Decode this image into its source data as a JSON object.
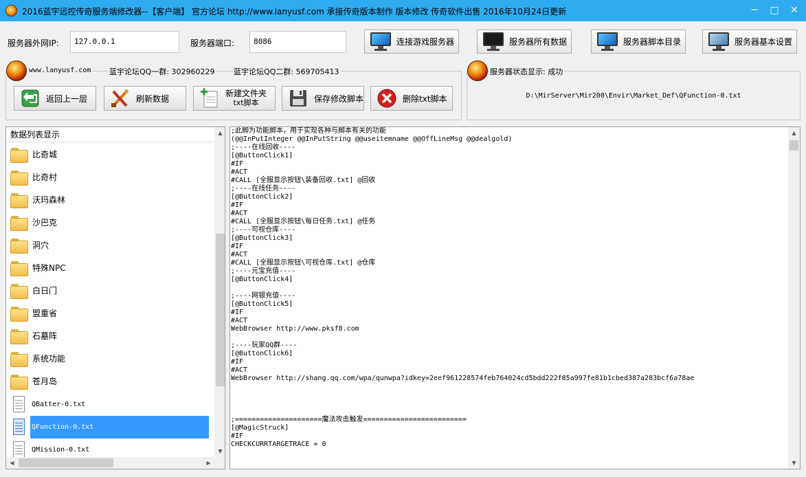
{
  "window": {
    "title": "2016蓝宇远控传奇服务端修改器--【客户端】   官方论坛 http://www.lanyusf.com  承接传奇版本制作 版本修改 传奇软件出售 2016年10月24日更新",
    "controls": {
      "minimize": "─",
      "maximize": "□",
      "close": "✕"
    }
  },
  "server": {
    "ip_label": "服务器外网IP:",
    "ip_value": "127.0.0.1",
    "port_label": "服务器端口:",
    "port_value": "8086"
  },
  "toolbar": {
    "connect": "连接游戏服务器",
    "all_data": "服务器所有数据",
    "script_dir": "服务器脚本目录",
    "basic_settings": "服务器基本设置"
  },
  "info_group": {
    "site": "www.lanyusf.com",
    "qq1": "蓝宇论坛QQ一群: 302960229",
    "qq2": "蓝宇论坛QQ二群: 569705413"
  },
  "actions": {
    "back": "返回上一层",
    "refresh": "刷新数据",
    "new_line1": "新建文件夹",
    "new_line2": "txt脚本",
    "save": "保存修改脚本",
    "delete": "删除txt脚本"
  },
  "status_group": {
    "label": "服务器状态显示: 成功",
    "path": "D:\\MirServer\\Mir200\\Envir\\Market_Def\\QFunction-0.txt"
  },
  "list": {
    "header": "数据列表显示",
    "items": [
      {
        "label": "比奇城",
        "type": "folder"
      },
      {
        "label": "比奇村",
        "type": "folder"
      },
      {
        "label": "沃玛森林",
        "type": "folder"
      },
      {
        "label": "沙巴克",
        "type": "folder"
      },
      {
        "label": "洞穴",
        "type": "folder"
      },
      {
        "label": "特殊NPC",
        "type": "folder"
      },
      {
        "label": "白日门",
        "type": "folder"
      },
      {
        "label": "盟重省",
        "type": "folder"
      },
      {
        "label": "石墓阵",
        "type": "folder"
      },
      {
        "label": "系统功能",
        "type": "folder"
      },
      {
        "label": "苍月岛",
        "type": "folder"
      },
      {
        "label": "QBatter-0.txt",
        "type": "file"
      },
      {
        "label": "QFunction-0.txt",
        "type": "file",
        "selected": true
      },
      {
        "label": "QMission-0.txt",
        "type": "file"
      }
    ]
  },
  "script": {
    "lines": [
      ";此脚为功能脚本，用于实现各种与脚本有关的功能",
      "(@@InPutInteger @@InPutString @@useitemname @@OffLineMsg @@dealgold)",
      ";----在线回收----",
      "[@ButtonClick1]",
      "#IF",
      "#ACT",
      "#CALL [全服显示按钮\\装备回收.txt] @回收",
      ";----在线任务----",
      "[@ButtonClick2]",
      "#IF",
      "#ACT",
      "#CALL [全服显示按钮\\每日任务.txt] @任务",
      ";----可视仓库----",
      "[@ButtonClick3]",
      "#IF",
      "#ACT",
      "#CALL [全服显示按钮\\可视仓库.txt] @仓库",
      ";----元宝充值----",
      "[@ButtonClick4]",
      "",
      ";----网银充值----",
      "[@ButtonClick5]",
      "#IF",
      "#ACT",
      "WebBrowser http://www.pksf8.com",
      "",
      ";----玩家QQ群----",
      "[@ButtonClick6]",
      "#IF",
      "#ACT",
      "WebBrowser http://shang.qq.com/wpa/qunwpa?idkey=2eef961228574feb764024cd5bdd222f85a997fe81b1cbed387a283bcf6a78ae",
      "",
      "",
      "",
      "",
      ";=====================魔法攻击触发=========================",
      "[@MagicStruck]",
      "#IF",
      "CHECKCURRTARGETRACE = 0"
    ]
  }
}
